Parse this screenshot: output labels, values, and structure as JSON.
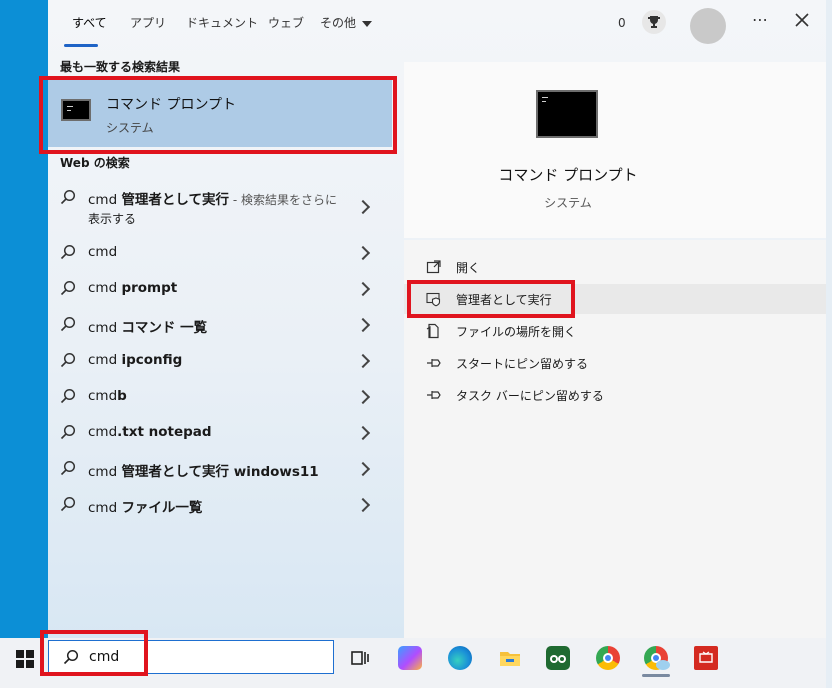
{
  "tabs": [
    {
      "label": "すべて"
    },
    {
      "label": "アプリ"
    },
    {
      "label": "ドキュメント"
    },
    {
      "label": "ウェブ"
    },
    {
      "label": "その他"
    }
  ],
  "header": {
    "points": "0"
  },
  "left": {
    "best_match_title": "最も一致する検索結果",
    "best_match": {
      "name": "コマンド プロンプト",
      "subtitle": "システム"
    },
    "web_title": "Web の検索",
    "web_results": [
      {
        "prefix": "cmd ",
        "bold": "管理者として実行",
        "suffix": " - 検索結果をさらに",
        "line2": "表示する"
      },
      {
        "prefix": "cmd",
        "bold": "",
        "suffix": ""
      },
      {
        "prefix": "cmd ",
        "bold": "prompt",
        "suffix": ""
      },
      {
        "prefix": "cmd ",
        "bold": "コマンド 一覧",
        "suffix": ""
      },
      {
        "prefix": "cmd ",
        "bold": "ipconfig",
        "suffix": ""
      },
      {
        "prefix": "cmd",
        "bold": "b",
        "suffix": ""
      },
      {
        "prefix": "cmd",
        "bold": ".txt notepad",
        "suffix": ""
      },
      {
        "prefix": "cmd ",
        "bold": "管理者として実行 windows11",
        "suffix": ""
      },
      {
        "prefix": "cmd ",
        "bold": "ファイル一覧",
        "suffix": ""
      }
    ]
  },
  "right": {
    "app_name": "コマンド プロンプト",
    "app_subtitle": "システム",
    "actions": [
      {
        "label": "開く",
        "icon": "open-icon"
      },
      {
        "label": "管理者として実行",
        "icon": "admin-shield-icon"
      },
      {
        "label": "ファイルの場所を開く",
        "icon": "file-location-icon"
      },
      {
        "label": "スタートにピン留めする",
        "icon": "pin-icon"
      },
      {
        "label": "タスク バーにピン留めする",
        "icon": "pin-icon"
      }
    ]
  },
  "taskbar": {
    "search_value": "cmd",
    "apps": [
      "task-view-icon",
      "copilot-icon",
      "edge-icon",
      "file-explorer-icon",
      "tripadvisor-icon",
      "chrome-icon",
      "chrome-profile-icon",
      "red-app-icon"
    ]
  },
  "colors": {
    "accent": "#1e63c6",
    "highlight": "#e0141e",
    "selection": "#aecbe6",
    "desktop": "#0d91d8"
  }
}
